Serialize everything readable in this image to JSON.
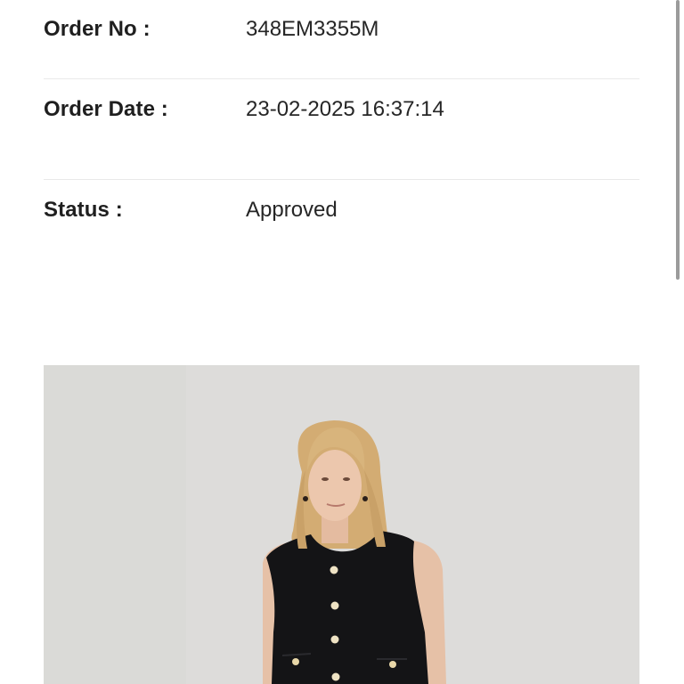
{
  "order": {
    "number_label": "Order No :",
    "number_value": "348EM3355M",
    "date_label": "Order Date :",
    "date_value": "23-02-2025 16:37:14",
    "status_label": "Status :",
    "status_value": "Approved"
  },
  "product_image": {
    "description": "photo-of-model-in-black-sleeveless-vest"
  },
  "colors": {
    "text": "#1f1f1f",
    "divider": "#e9e9e9",
    "image_bg": "#dcdbd9",
    "vest": "#141416",
    "hair": "#d8b47c",
    "button": "#efe3c4"
  }
}
